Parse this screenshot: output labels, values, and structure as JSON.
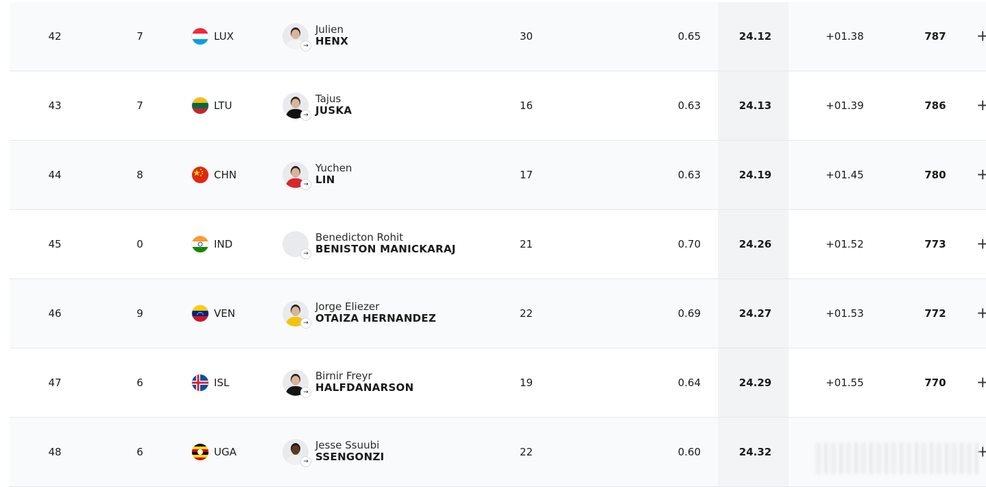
{
  "rows": [
    {
      "rank": "42",
      "hf": "7",
      "noc": "LUX",
      "first": "Julien",
      "last": "HENX",
      "age": "30",
      "rt": "0.65",
      "time": "24.12",
      "diff": "+01.38",
      "pts": "787",
      "plus": "+",
      "flag": "flag-lux",
      "shirt": "#f3f3f3"
    },
    {
      "rank": "43",
      "hf": "7",
      "noc": "LTU",
      "first": "Tajus",
      "last": "JUSKA",
      "age": "16",
      "rt": "0.63",
      "time": "24.13",
      "diff": "+01.39",
      "pts": "786",
      "plus": "+",
      "flag": "flag-ltu",
      "shirt": "#111111"
    },
    {
      "rank": "44",
      "hf": "8",
      "noc": "CHN",
      "first": "Yuchen",
      "last": "LIN",
      "age": "17",
      "rt": "0.63",
      "time": "24.19",
      "diff": "+01.45",
      "pts": "780",
      "plus": "+",
      "flag": "flag-chn",
      "shirt": "#d9262e"
    },
    {
      "rank": "45",
      "hf": "0",
      "noc": "IND",
      "first": "Benedicton Rohit",
      "last": "BENISTON MANICKARAJ",
      "age": "21",
      "rt": "0.70",
      "time": "24.26",
      "diff": "+01.52",
      "pts": "773",
      "plus": "+",
      "flag": "flag-ind",
      "shirt": "none"
    },
    {
      "rank": "46",
      "hf": "9",
      "noc": "VEN",
      "first": "Jorge Eliezer",
      "last": "OTAIZA HERNANDEZ",
      "age": "22",
      "rt": "0.69",
      "time": "24.27",
      "diff": "+01.53",
      "pts": "772",
      "plus": "+",
      "flag": "flag-ven",
      "shirt": "#f2c40f"
    },
    {
      "rank": "47",
      "hf": "6",
      "noc": "ISL",
      "first": "Birnir Freyr",
      "last": "HALFDANARSON",
      "age": "19",
      "rt": "0.64",
      "time": "24.29",
      "diff": "+01.55",
      "pts": "770",
      "plus": "+",
      "flag": "flag-isl",
      "shirt": "#151515"
    },
    {
      "rank": "48",
      "hf": "6",
      "noc": "UGA",
      "first": "Jesse Ssuubi",
      "last": "SSENGONZI",
      "age": "22",
      "rt": "0.60",
      "time": "24.32",
      "diff": "",
      "pts": "",
      "plus": "+",
      "flag": "flag-uga",
      "shirt": "#f0f0f0"
    }
  ],
  "icons": {
    "profile_link": "arrow-right-icon",
    "expand": "plus-icon"
  }
}
